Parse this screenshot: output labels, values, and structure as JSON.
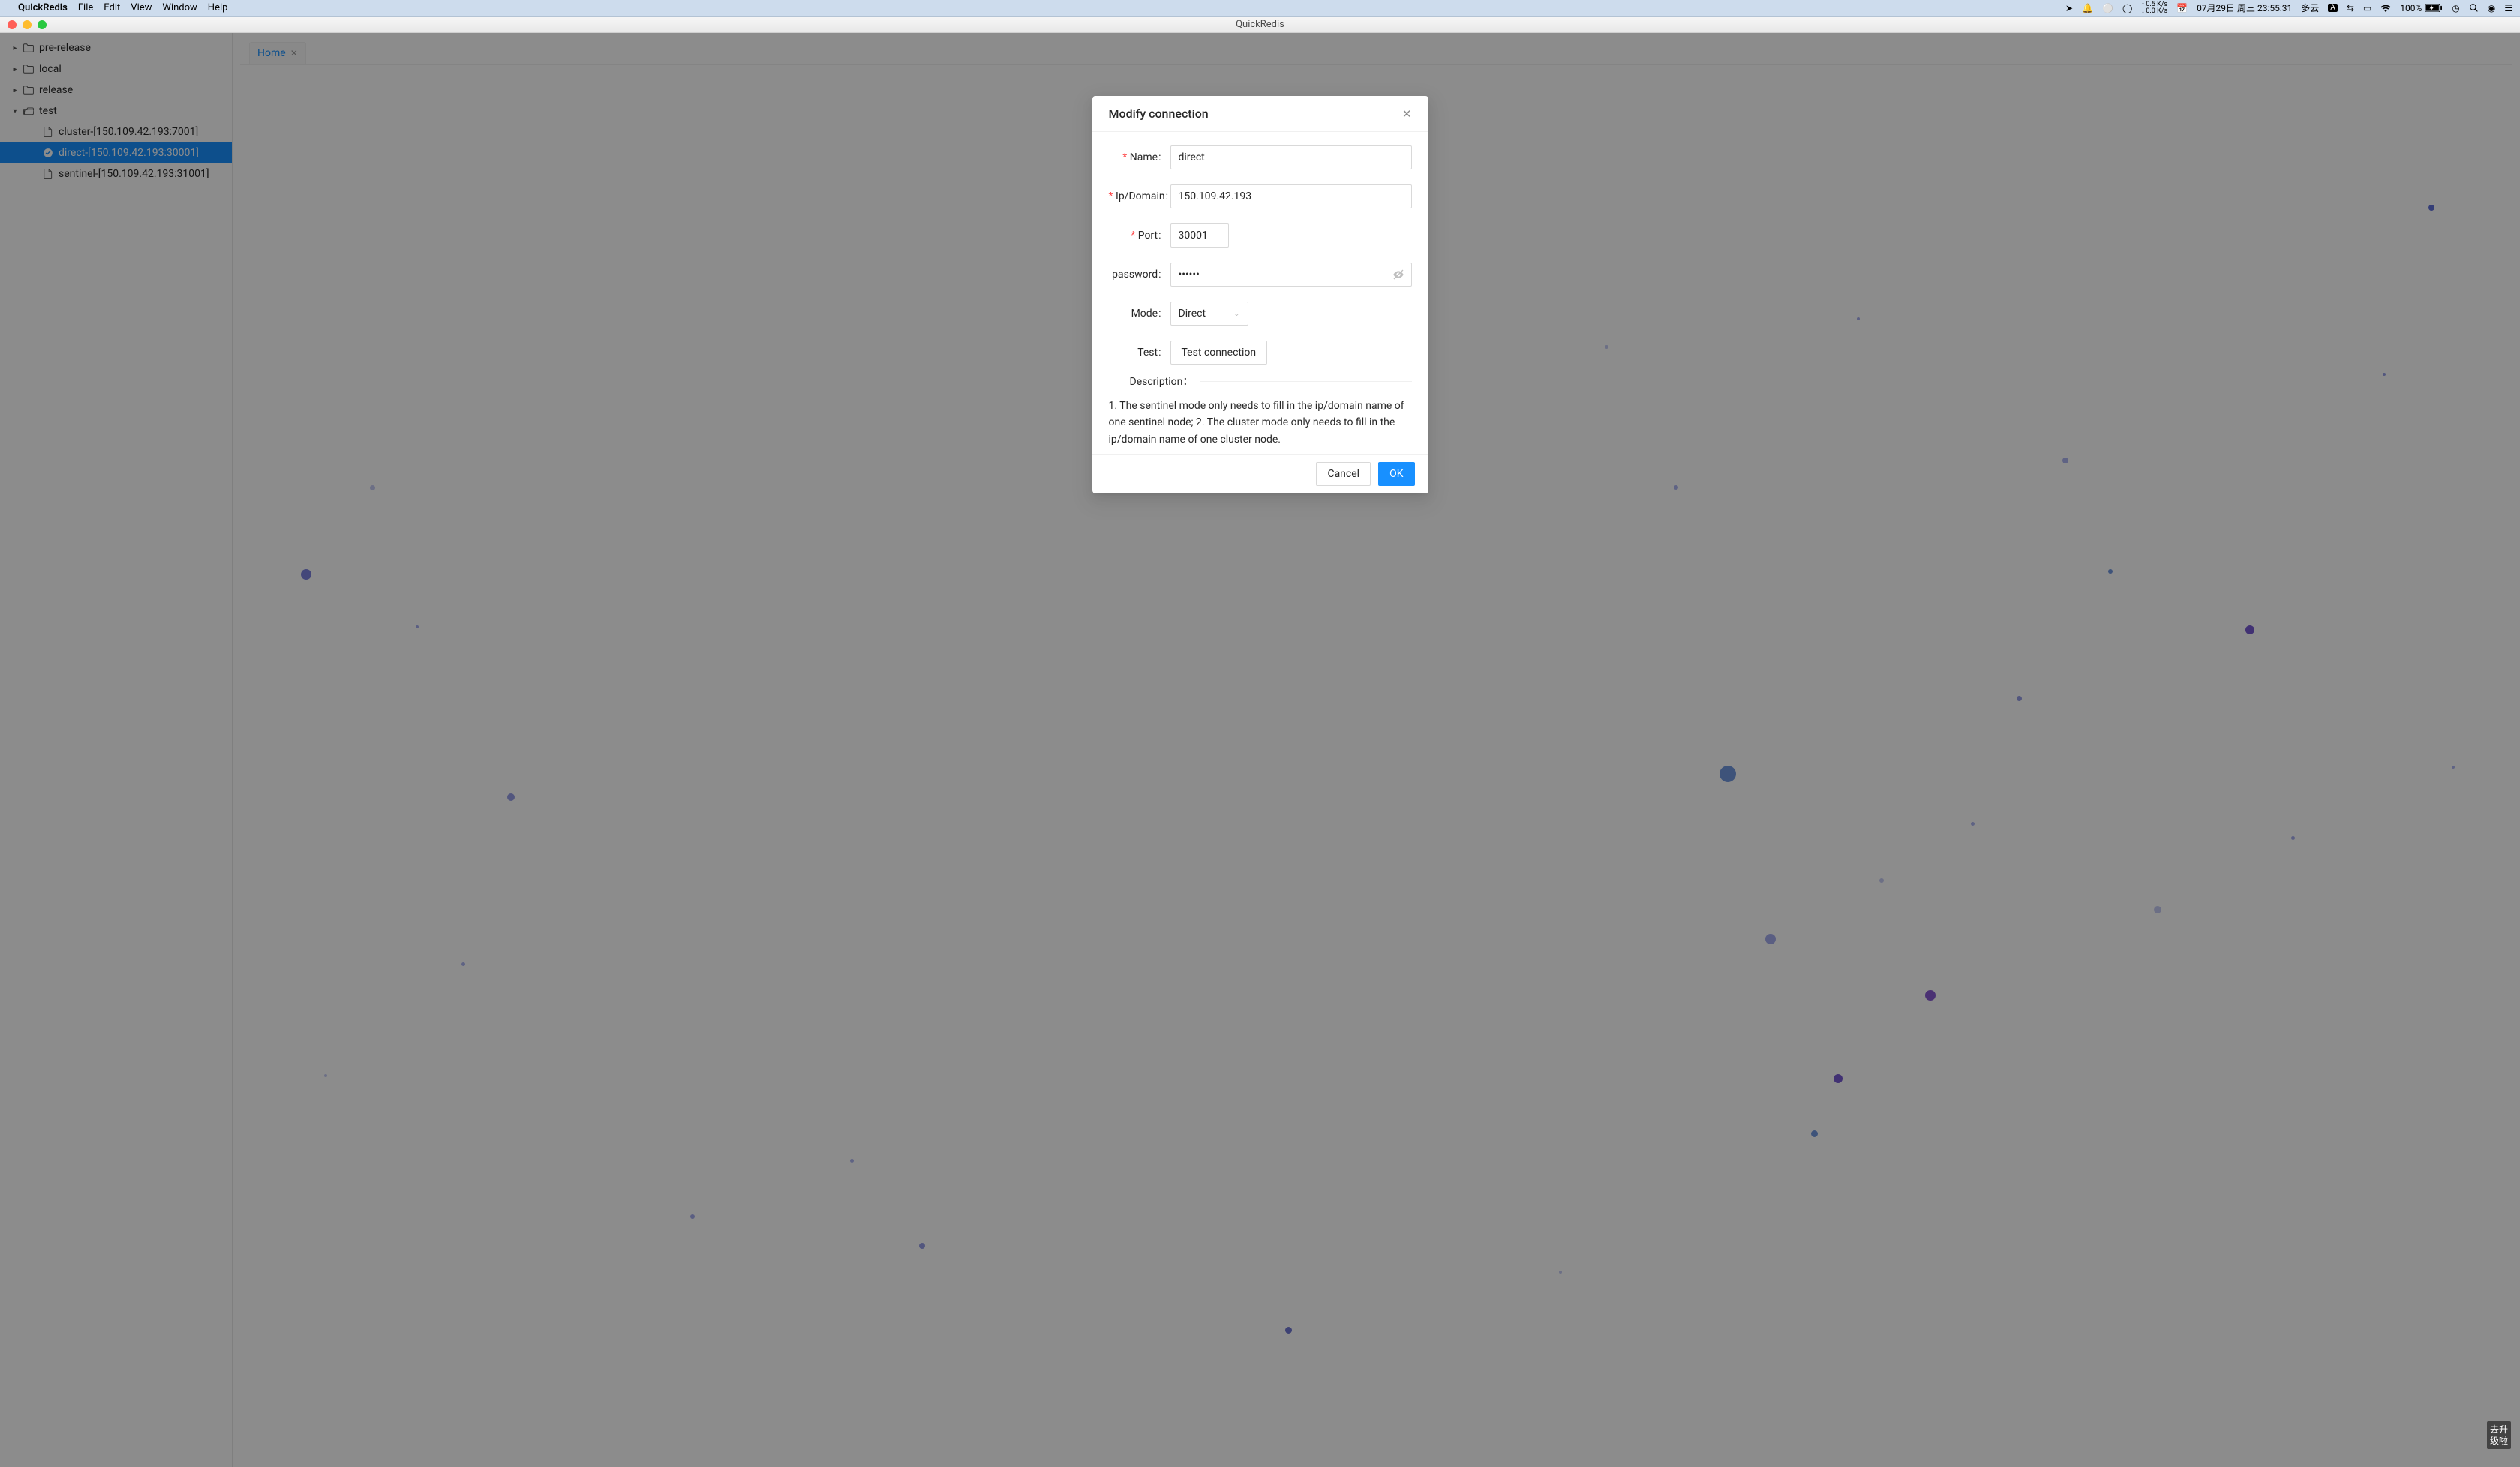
{
  "menubar": {
    "app": "QuickRedis",
    "items": [
      "File",
      "Edit",
      "View",
      "Window",
      "Help"
    ],
    "right": {
      "netUp": "0.5 K/s",
      "netDn": "0.0 K/s",
      "date": "07月29日 周三 23:55:31",
      "weather": "多云",
      "ime": "A",
      "battery": "100%"
    }
  },
  "window": {
    "title": "QuickRedis"
  },
  "sidebar": {
    "items": [
      {
        "label": "pre-release",
        "type": "folder",
        "expanded": false
      },
      {
        "label": "local",
        "type": "folder",
        "expanded": false
      },
      {
        "label": "release",
        "type": "folder",
        "expanded": false
      },
      {
        "label": "test",
        "type": "folder",
        "expanded": true,
        "children": [
          {
            "label": "cluster-[150.109.42.193:7001]",
            "selected": false,
            "status": "idle"
          },
          {
            "label": "direct-[150.109.42.193:30001]",
            "selected": true,
            "status": "ok"
          },
          {
            "label": "sentinel-[150.109.42.193:31001]",
            "selected": false,
            "status": "idle"
          }
        ]
      }
    ]
  },
  "tabs": {
    "items": [
      {
        "label": "Home"
      }
    ]
  },
  "modal": {
    "title": "Modify connection",
    "fields": {
      "name_label": "Name",
      "name_value": "direct",
      "ip_label": "Ip/Domain",
      "ip_value": "150.109.42.193",
      "port_label": "Port",
      "port_value": "30001",
      "password_label": "password",
      "password_value": "••••••",
      "mode_label": "Mode",
      "mode_value": "Direct",
      "test_label": "Test",
      "test_button": "Test connection"
    },
    "description_label": "Description：",
    "description_text": "1. The sentinel mode only needs to fill in the ip/domain name of one sentinel node; 2. The cluster mode only needs to fill in the ip/domain name of one cluster node.",
    "cancel": "Cancel",
    "ok": "OK"
  },
  "upgrade_badge": "去升\n级啦"
}
